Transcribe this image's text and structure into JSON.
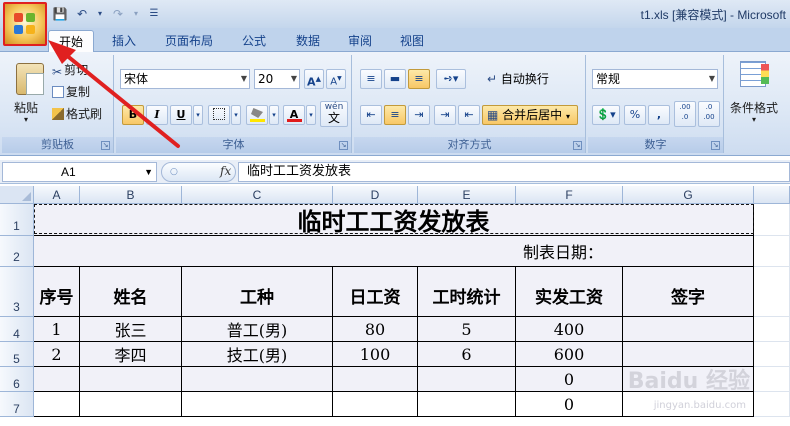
{
  "window": {
    "title": "t1.xls  [兼容模式] - Microsoft"
  },
  "tabs": [
    "开始",
    "插入",
    "页面布局",
    "公式",
    "数据",
    "审阅",
    "视图"
  ],
  "clipboard": {
    "paste": "粘贴",
    "cut": "剪切",
    "copy": "复制",
    "format_painter": "格式刷",
    "label": "剪贴板"
  },
  "font": {
    "name": "宋体",
    "size": "20",
    "grow": "A",
    "shrink": "A",
    "bold": "B",
    "italic": "I",
    "underline": "U",
    "font_color": "A",
    "phonetic": "wén",
    "phonetic_char": "文",
    "label": "字体"
  },
  "alignment": {
    "wrap_text": "自动换行",
    "merge_center": "合并后居中",
    "label": "对齐方式"
  },
  "number": {
    "format": "常规",
    "percent": "%",
    "comma": ",",
    "inc_decimal": ".00 .0",
    "dec_decimal": ".0 .00",
    "label": "数字"
  },
  "styles": {
    "conditional_format": "条件格式"
  },
  "formula_bar": {
    "name_box": "A1",
    "fx": "fx",
    "content": "临时工工资发放表"
  },
  "sheet": {
    "columns": [
      "A",
      "B",
      "C",
      "D",
      "E",
      "F",
      "G"
    ],
    "rows": [
      "1",
      "2",
      "3",
      "4",
      "5",
      "6",
      "7"
    ],
    "title": "临时工工资发放表",
    "date_label": "制表日期：",
    "headers": [
      "序号",
      "姓名",
      "工种",
      "日工资",
      "工时统计",
      "实发工资",
      "签字"
    ],
    "data_rows": [
      [
        "1",
        "张三",
        "普工(男)",
        "80",
        "5",
        "400",
        ""
      ],
      [
        "2",
        "李四",
        "技工(男)",
        "100",
        "6",
        "600",
        ""
      ],
      [
        "",
        "",
        "",
        "",
        "",
        "0",
        ""
      ],
      [
        "",
        "",
        "",
        "",
        "",
        "0",
        ""
      ]
    ]
  },
  "watermark": {
    "text": "Baidu 经验",
    "sub": "jingyan.baidu.com"
  },
  "annotation": {
    "color": "#e02020"
  }
}
